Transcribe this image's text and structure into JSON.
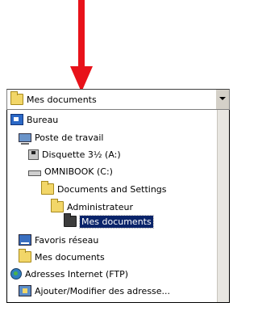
{
  "combo": {
    "selected": "Mes documents",
    "arrow_icon": "chevron-down-icon"
  },
  "list": {
    "items": [
      {
        "label": "Bureau",
        "icon": "desktop-icon"
      },
      {
        "label": "Poste de travail",
        "icon": "computer-icon"
      },
      {
        "label": "Disquette 3½ (A:)",
        "icon": "floppy-icon"
      },
      {
        "label": "OMNIBOOK (C:)",
        "icon": "drive-icon"
      },
      {
        "label": "Documents and Settings",
        "icon": "folder-icon"
      },
      {
        "label": "Administrateur",
        "icon": "folder-icon"
      },
      {
        "label": "Mes documents",
        "icon": "folder-icon",
        "selected": true
      },
      {
        "label": "Favoris réseau",
        "icon": "network-icon"
      },
      {
        "label": "Mes documents",
        "icon": "folder-icon"
      },
      {
        "label": "Adresses Internet (FTP)",
        "icon": "globe-icon"
      },
      {
        "label": "Ajouter/Modifier des adresse...",
        "icon": "ftp-icon"
      }
    ]
  },
  "colors": {
    "arrow": "#e8121a",
    "selection": "#0a246a"
  }
}
